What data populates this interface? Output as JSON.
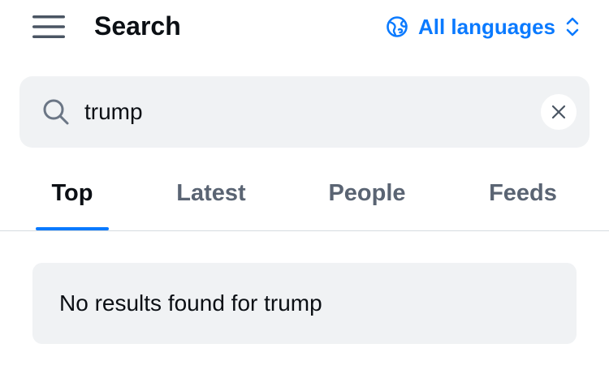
{
  "header": {
    "title": "Search",
    "menu_icon": "hamburger-menu-icon",
    "language_selector": {
      "label": "All languages",
      "icon": "globe-icon",
      "chevron": "up-down-chevron-icon"
    }
  },
  "search": {
    "query": "trump",
    "icon": "search-icon",
    "clear_icon": "close-icon"
  },
  "tabs": [
    {
      "label": "Top",
      "active": true
    },
    {
      "label": "Latest",
      "active": false
    },
    {
      "label": "People",
      "active": false
    },
    {
      "label": "Feeds",
      "active": false
    }
  ],
  "results": {
    "empty_message": "No results found for trump"
  },
  "colors": {
    "accent": "#0a7aff",
    "text_primary": "#0b0f14",
    "text_secondary": "#5a6473",
    "surface": "#f0f2f4",
    "divider": "#d6dbe0"
  }
}
